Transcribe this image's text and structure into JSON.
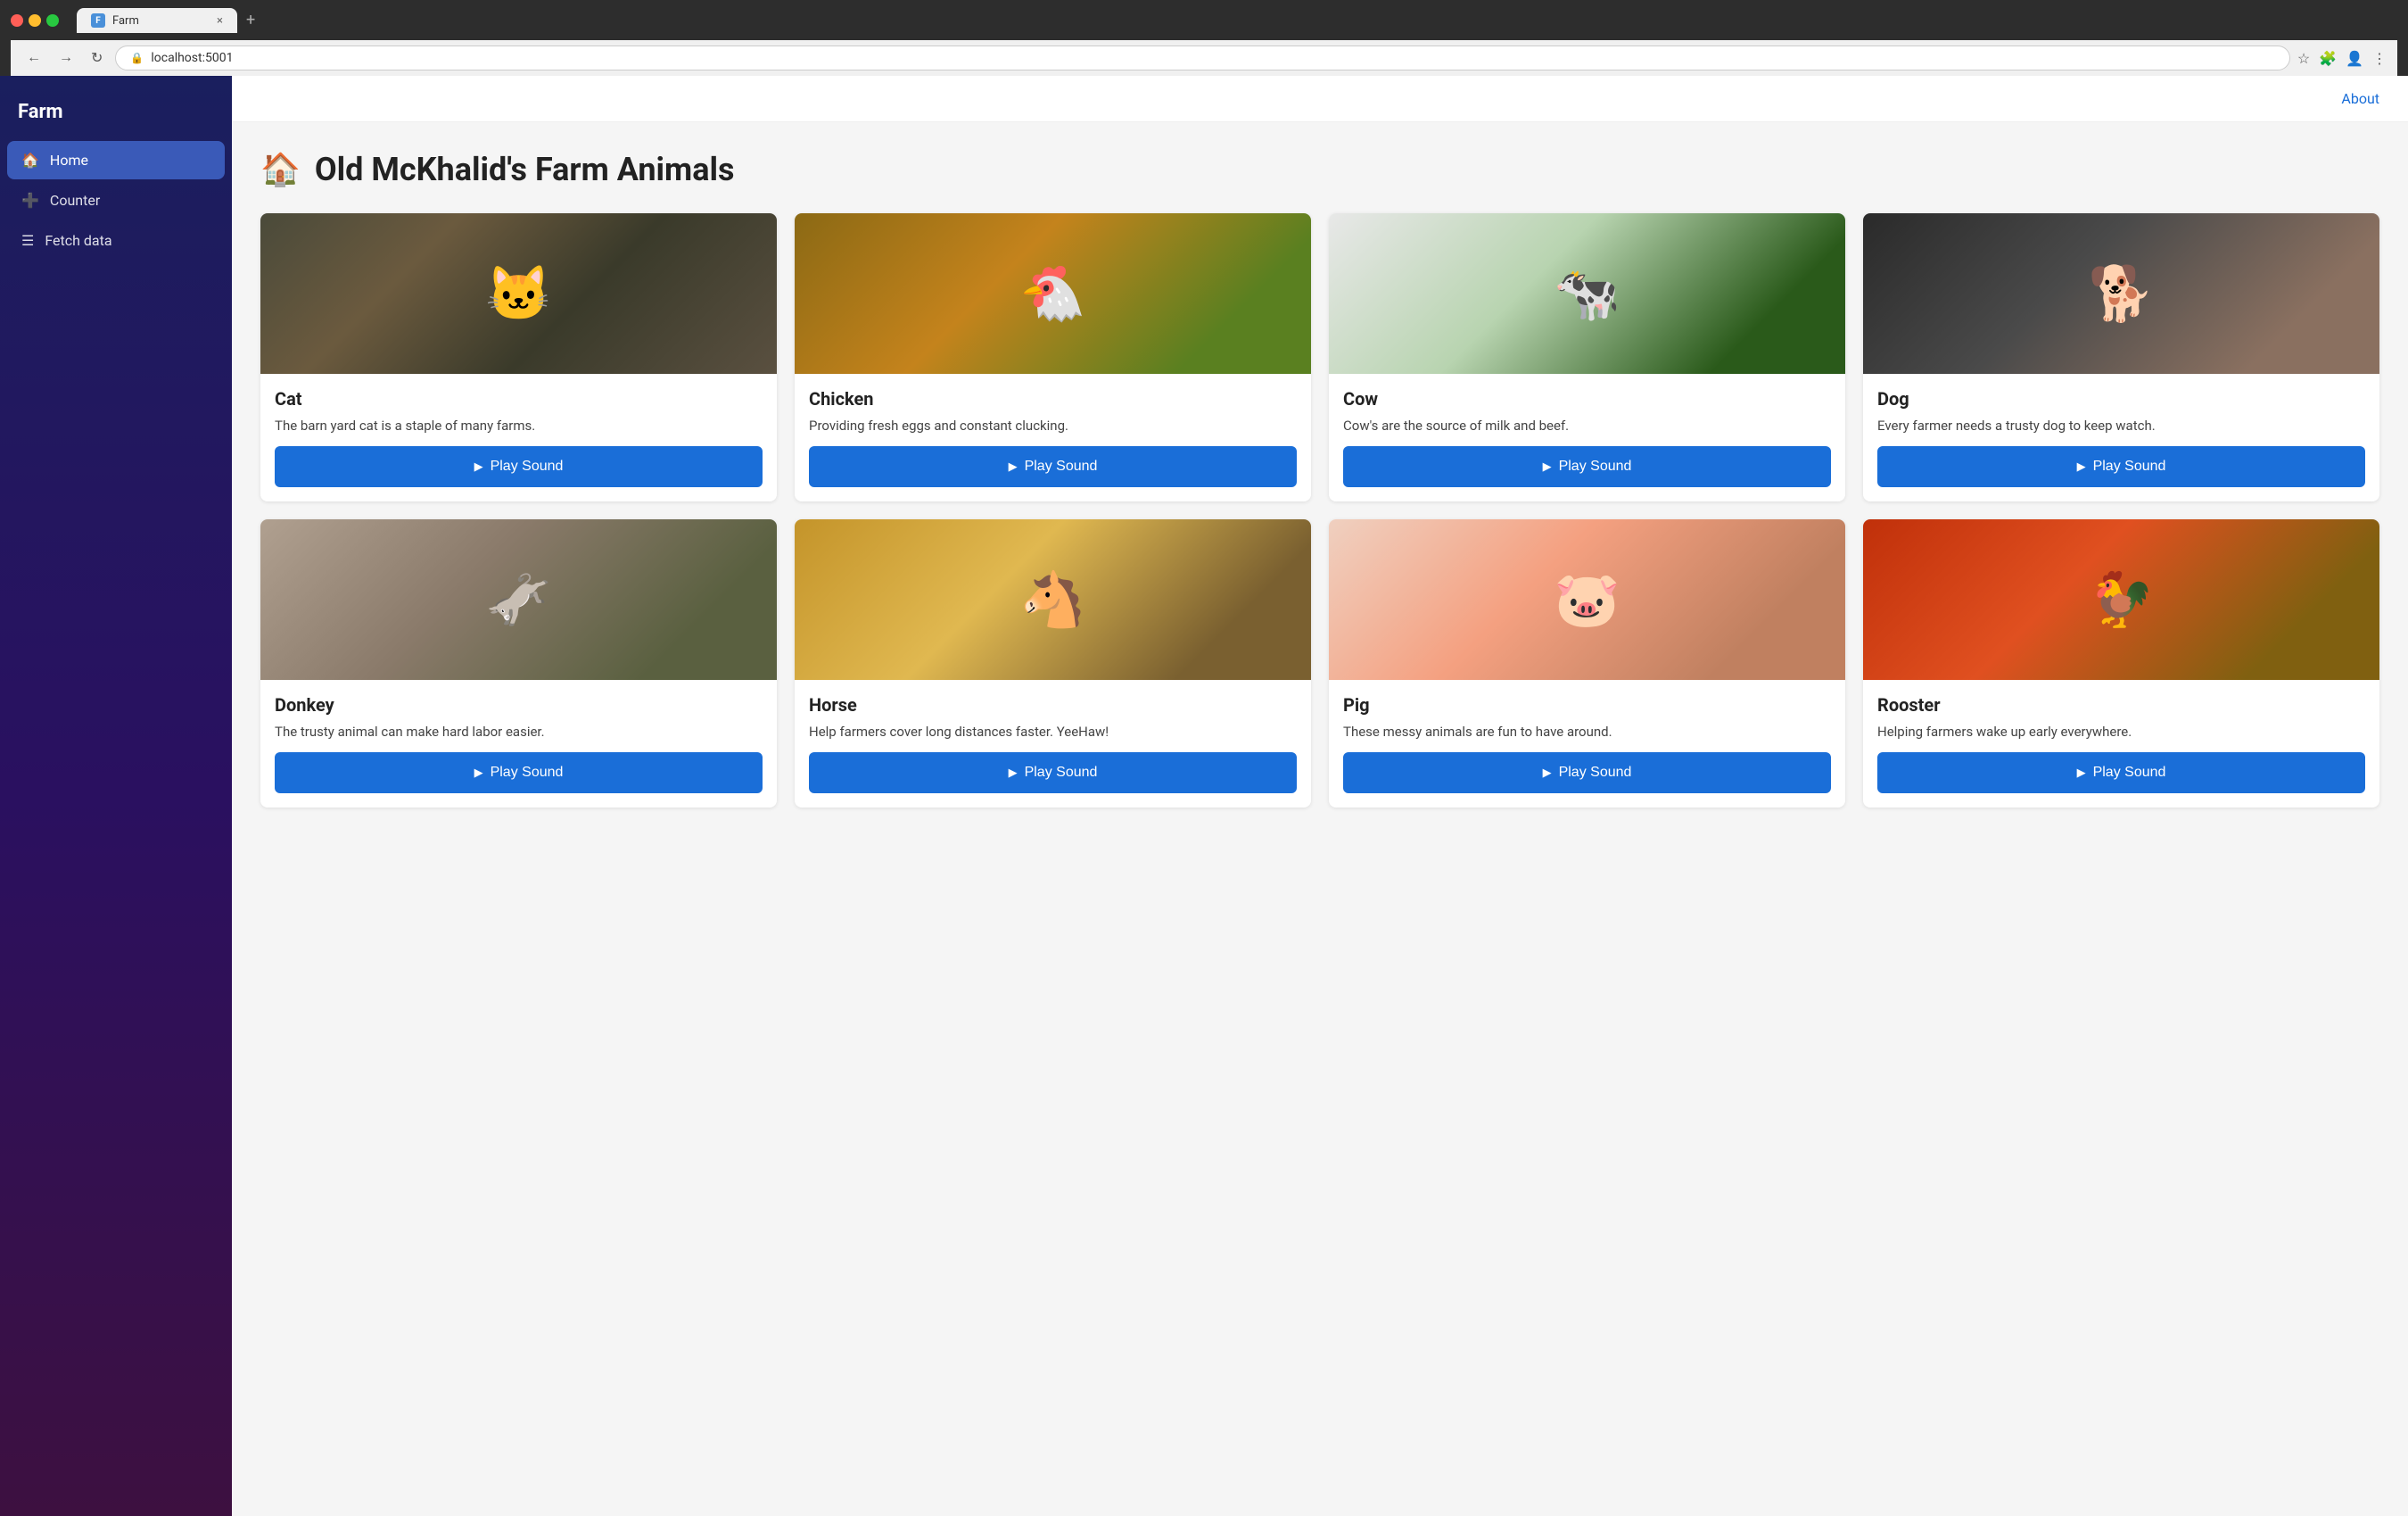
{
  "browser": {
    "tab_label": "Farm",
    "url": "localhost:5001",
    "new_tab_symbol": "+",
    "close_tab_symbol": "×"
  },
  "sidebar": {
    "title": "Farm",
    "items": [
      {
        "id": "home",
        "label": "Home",
        "icon": "🏠",
        "active": true
      },
      {
        "id": "counter",
        "label": "Counter",
        "icon": "➕",
        "active": false
      },
      {
        "id": "fetch-data",
        "label": "Fetch data",
        "icon": "☰",
        "active": false
      }
    ]
  },
  "header": {
    "about_label": "About"
  },
  "page": {
    "title": "Old McKhalid's Farm Animals",
    "title_icon": "🏠"
  },
  "animals": [
    {
      "id": "cat",
      "name": "Cat",
      "description": "The barn yard cat is a staple of many farms.",
      "image_class": "img-cat",
      "button_label": "Play Sound"
    },
    {
      "id": "chicken",
      "name": "Chicken",
      "description": "Providing fresh eggs and constant clucking.",
      "image_class": "img-chicken",
      "button_label": "Play Sound"
    },
    {
      "id": "cow",
      "name": "Cow",
      "description": "Cow's are the source of milk and beef.",
      "image_class": "img-cow",
      "button_label": "Play Sound"
    },
    {
      "id": "dog",
      "name": "Dog",
      "description": "Every farmer needs a trusty dog to keep watch.",
      "image_class": "img-dog",
      "button_label": "Play Sound"
    },
    {
      "id": "donkey",
      "name": "Donkey",
      "description": "The trusty animal can make hard labor easier.",
      "image_class": "img-donkey",
      "button_label": "Play Sound"
    },
    {
      "id": "horse",
      "name": "Horse",
      "description": "Help farmers cover long distances faster. YeeHaw!",
      "image_class": "img-horse",
      "button_label": "Play Sound"
    },
    {
      "id": "pig",
      "name": "Pig",
      "description": "These messy animals are fun to have around.",
      "image_class": "img-pig",
      "button_label": "Play Sound"
    },
    {
      "id": "rooster",
      "name": "Rooster",
      "description": "Helping farmers wake up early everywhere.",
      "image_class": "img-rooster",
      "button_label": "Play Sound"
    }
  ],
  "icons": {
    "play": "▶",
    "lock": "🔒",
    "star": "☆",
    "puzzle": "🧩",
    "avatar": "👤",
    "menu": "⋮",
    "back": "←",
    "forward": "→",
    "reload": "↻",
    "home_sidebar": "⌂",
    "plus_sidebar": "+",
    "grid_sidebar": "≡"
  },
  "colors": {
    "accent": "#1a6ed8",
    "sidebar_bg_top": "#1a1f5e",
    "sidebar_bg_bottom": "#3d1040",
    "active_nav": "#3a5ab8"
  }
}
